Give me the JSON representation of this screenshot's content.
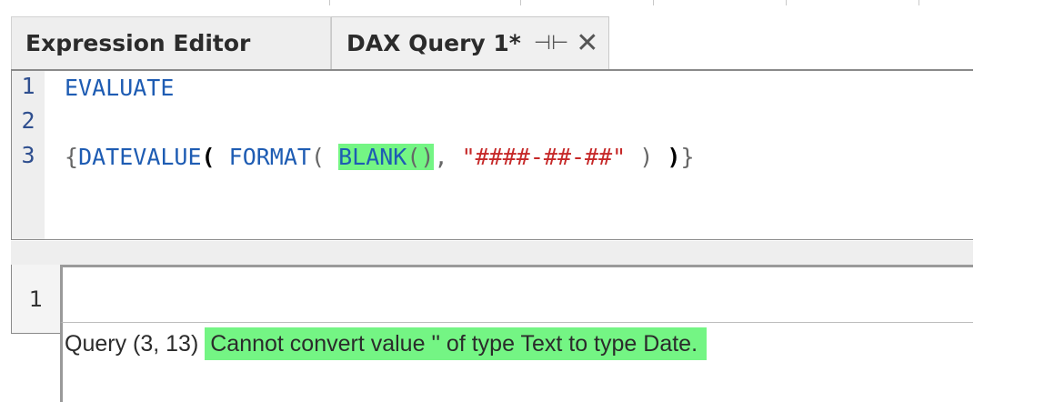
{
  "tabs": [
    {
      "label": "Expression Editor",
      "active": false
    },
    {
      "label": "DAX Query 1*",
      "active": true
    }
  ],
  "icons": {
    "pin": "pin-icon",
    "close": "close-icon"
  },
  "editor": {
    "line_numbers": [
      "1",
      "2",
      "3"
    ],
    "line1": {
      "keyword": "EVALUATE"
    },
    "line3": {
      "brace_open": "{",
      "datevalue": "DATEVALUE",
      "paren1_open": "(",
      "format": "FORMAT",
      "paren2_open": "(",
      "blank": "BLANK",
      "blank_parens": "()",
      "comma": ",",
      "format_string": "\"####-##-##\"",
      "paren2_close": ")",
      "paren1_close": ")",
      "brace_close": "}"
    }
  },
  "results": {
    "row_number": "1",
    "message_prefix": "Query (3, 13)",
    "message_error": "Cannot convert value '' of type Text to type Date."
  },
  "colors": {
    "highlight": "#74f584",
    "keyword": "#1e5cb3",
    "string": "#c62828",
    "line_number": "#2f4f8f"
  }
}
